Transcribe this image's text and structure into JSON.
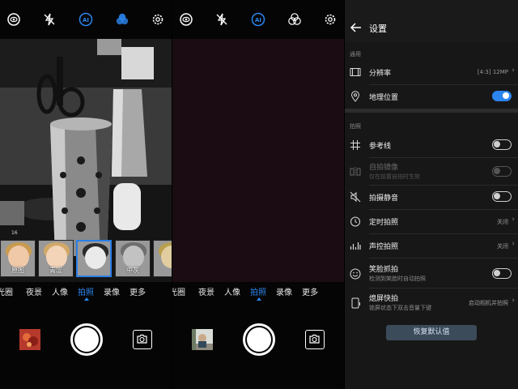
{
  "screens": {
    "camera_filter": {
      "top_icons": [
        "eye-icon",
        "flash-off-icon",
        "ai-icon",
        "filter-icon",
        "gear-icon"
      ],
      "filters": [
        {
          "label": "原图"
        },
        {
          "label": "青涩"
        },
        {
          "label": ""
        },
        {
          "label": "中灰"
        },
        {
          "label": ""
        }
      ],
      "badge": "16",
      "modes": [
        "光圈",
        "夜景",
        "人像",
        "拍照",
        "录像",
        "更多"
      ],
      "active_mode": "拍照"
    },
    "camera_plain": {
      "top_icons": [
        "eye-icon",
        "flash-off-icon",
        "ai-icon",
        "filter-icon",
        "gear-icon"
      ],
      "modes": [
        "光圈",
        "夜景",
        "人像",
        "拍照",
        "录像",
        "更多"
      ],
      "active_mode": "拍照"
    }
  },
  "settings": {
    "title": "设置",
    "section_general": "通用",
    "resolution": {
      "title": "分辨率",
      "value": "[4:3] 12MP"
    },
    "location": {
      "title": "地理位置",
      "enabled": true
    },
    "section_photo": "拍照",
    "grid": {
      "title": "参考线",
      "enabled": false
    },
    "mirror": {
      "title": "自拍镜像",
      "subtitle": "仅在前置自拍时生效",
      "enabled": false,
      "disabled": true
    },
    "mute": {
      "title": "拍摄静音",
      "enabled": false
    },
    "timer": {
      "title": "定时拍照",
      "value": "关闭"
    },
    "voice": {
      "title": "声控拍照",
      "value": "关闭"
    },
    "smile": {
      "title": "笑脸抓拍",
      "subtitle": "检测到笑脸时自动拍照",
      "enabled": false
    },
    "snapshot": {
      "title": "熄屏快拍",
      "subtitle": "锁屏状态下双击音量下键",
      "value": "启动相机并拍照"
    },
    "restore": "恢复默认值"
  },
  "colors": {
    "accent": "#2c85ee",
    "panel_bg": "#171717",
    "viewfinder_tint": "#1a0c12"
  }
}
